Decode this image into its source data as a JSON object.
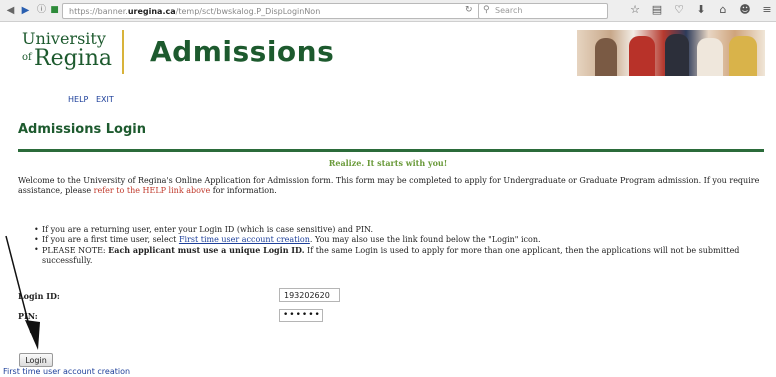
{
  "browser": {
    "url_prefix": "https://banner.",
    "url_domain": "uregina.ca",
    "url_path": "/temp/sct/bwskalog.P_DispLoginNon",
    "search_placeholder": "Search"
  },
  "header": {
    "logo_university": "University",
    "logo_of": "of",
    "logo_regina": "Regina",
    "title": "Admissions"
  },
  "nav": {
    "help": "HELP",
    "exit": "EXIT"
  },
  "page": {
    "title": "Admissions Login",
    "tagline": "Realize. It starts with you!",
    "welcome_text": "Welcome to the University of Regina's Online Application for Admission form. This form may be completed to apply for Undergraduate or Graduate Program admission. If you require assistance, please",
    "welcome_link": "refer to the HELP link above",
    "welcome_end": "for information."
  },
  "instructions": {
    "item1": "If you are a returning user, enter your Login ID (which is case sensitive) and PIN.",
    "item2_pre": "If you are a first time user, select",
    "item2_link": "First time user account creation",
    "item2_post": ". You may also use the link found below the \"Login\" icon.",
    "item3_pre": "PLEASE NOTE:",
    "item3_bold": "Each applicant must use a unique Login ID.",
    "item3_post": "If the same Login is used to apply for more than one applicant, then the applications will not be submitted successfully."
  },
  "form": {
    "login_id_label": "Login ID:",
    "login_id_value": "193202620",
    "pin_label": "PIN:",
    "pin_value": "••••••"
  },
  "actions": {
    "login_button": "Login",
    "first_time_link": "First time user account creation"
  }
}
